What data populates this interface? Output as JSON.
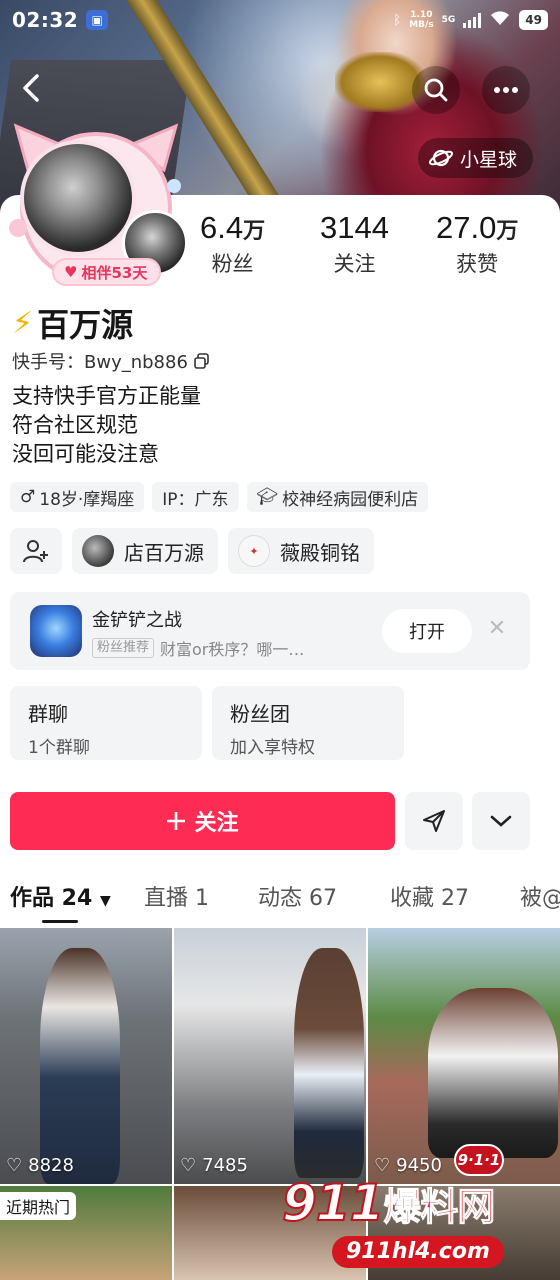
{
  "status_bar": {
    "time": "02:32",
    "net_speed_top": "1.10",
    "net_speed_bottom": "MB/s",
    "network": "5G",
    "battery": "49"
  },
  "header": {
    "planet_label": "小星球"
  },
  "profile": {
    "companion_badge": "相伴53天",
    "stats": [
      {
        "num": "6.4",
        "unit": "万",
        "label": "粉丝"
      },
      {
        "num": "3144",
        "unit": "",
        "label": "关注"
      },
      {
        "num": "27.0",
        "unit": "万",
        "label": "获赞"
      }
    ],
    "name": "百万源",
    "kuaishou_id": "快手号：Bwy_nb886",
    "bio_lines": [
      "支持快手官方正能量",
      "符合社区规范",
      "没回可能没注意"
    ],
    "tags": {
      "age": "18岁·摩羯座",
      "ip": "IP：广东",
      "school": "校神经病园便利店"
    },
    "links": {
      "shop": "店百万源",
      "brand": "薇殿铜铭"
    }
  },
  "game_card": {
    "title": "金铲铲之战",
    "badge": "粉丝推荐",
    "subtitle": "财富or秩序？哪一…",
    "open_label": "打开"
  },
  "features": [
    {
      "title": "群聊",
      "subtitle": "1个群聊"
    },
    {
      "title": "粉丝团",
      "subtitle": "加入享特权"
    }
  ],
  "actions": {
    "follow_label": "关注"
  },
  "tabs": [
    {
      "label": "作品 24"
    },
    {
      "label": "直播 1"
    },
    {
      "label": "动态 67"
    },
    {
      "label": "收藏 27"
    },
    {
      "label": "被@"
    }
  ],
  "videos": [
    {
      "likes": "8828"
    },
    {
      "likes": "7485"
    },
    {
      "likes": "9450"
    },
    {
      "likes": ""
    },
    {
      "likes": ""
    },
    {
      "likes": ""
    }
  ],
  "video_hot_label": "近期热门",
  "watermark": {
    "main_num": "911",
    "main_cn": "爆料网",
    "url": "911hl4.com",
    "badge": "9·1·1"
  }
}
